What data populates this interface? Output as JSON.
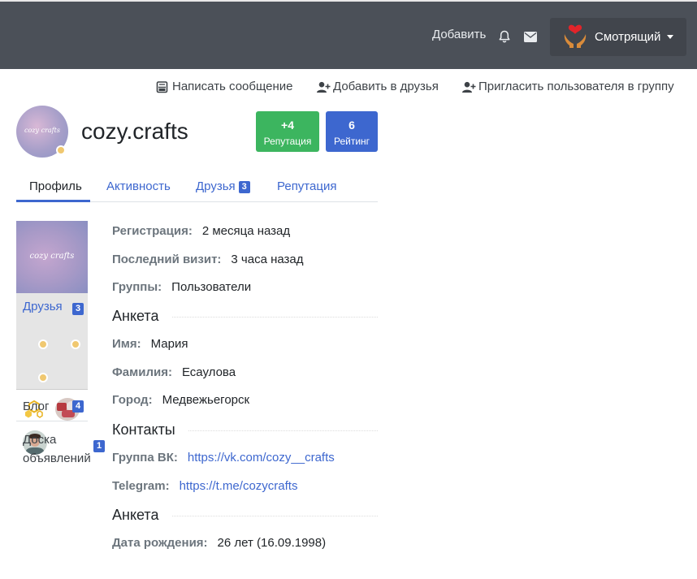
{
  "topbar": {
    "add_label": "Добавить",
    "user_name": "Смотрящий",
    "icons": [
      "bell-icon",
      "envelope-icon",
      "caret-down-icon"
    ],
    "background": "#4b5058"
  },
  "actions": [
    {
      "label": "Написать сообщение",
      "icon": "message-icon"
    },
    {
      "label": "Добавить в друзья",
      "icon": "user-plus-icon"
    },
    {
      "label": "Пригласить пользователя в группу",
      "icon": "user-plus-icon"
    }
  ],
  "profile": {
    "name": "cozy.crafts",
    "avatar_text": "cozy crafts",
    "reputation": {
      "value": "+4",
      "label": "Репутация",
      "color": "#3cb55f"
    },
    "rating": {
      "value": "6",
      "label": "Рейтинг",
      "color": "#3d67cf"
    }
  },
  "tabs": [
    {
      "label": "Профиль",
      "active": true
    },
    {
      "label": "Активность"
    },
    {
      "label": "Друзья",
      "count": "3"
    },
    {
      "label": "Репутация"
    }
  ],
  "sidebar": {
    "cover_text": "cozy crafts",
    "friends": {
      "label": "Друзья",
      "count": "3"
    },
    "blog": {
      "label": "Блог",
      "count": "4"
    },
    "board": {
      "label_line1": "Доска",
      "label_line2": "объявлений",
      "count": "1"
    }
  },
  "info": {
    "registration": {
      "key": "Регистрация:",
      "value": "2 месяца назад"
    },
    "last_visit": {
      "key": "Последний визит:",
      "value": "3 часа назад"
    },
    "groups": {
      "key": "Группы:",
      "value": "Пользователи"
    }
  },
  "anketa": {
    "title": "Анкета",
    "first_name": {
      "key": "Имя:",
      "value": "Мария"
    },
    "last_name": {
      "key": "Фамилия:",
      "value": "Есаулова"
    },
    "city": {
      "key": "Город:",
      "value": "Медвежьегорск"
    }
  },
  "contacts": {
    "title": "Контакты",
    "vk": {
      "key": "Группа ВК:",
      "value": "https://vk.com/cozy__crafts"
    },
    "telegram": {
      "key": "Telegram:",
      "value": "https://t.me/cozycrafts"
    }
  },
  "anketa2": {
    "title": "Анкета",
    "birthday": {
      "key": "Дата рождения:",
      "value": "26 лет (16.09.1998)"
    }
  },
  "colors": {
    "accent": "#3d67cf",
    "success": "#3cb55f",
    "online": "#f0c870"
  }
}
